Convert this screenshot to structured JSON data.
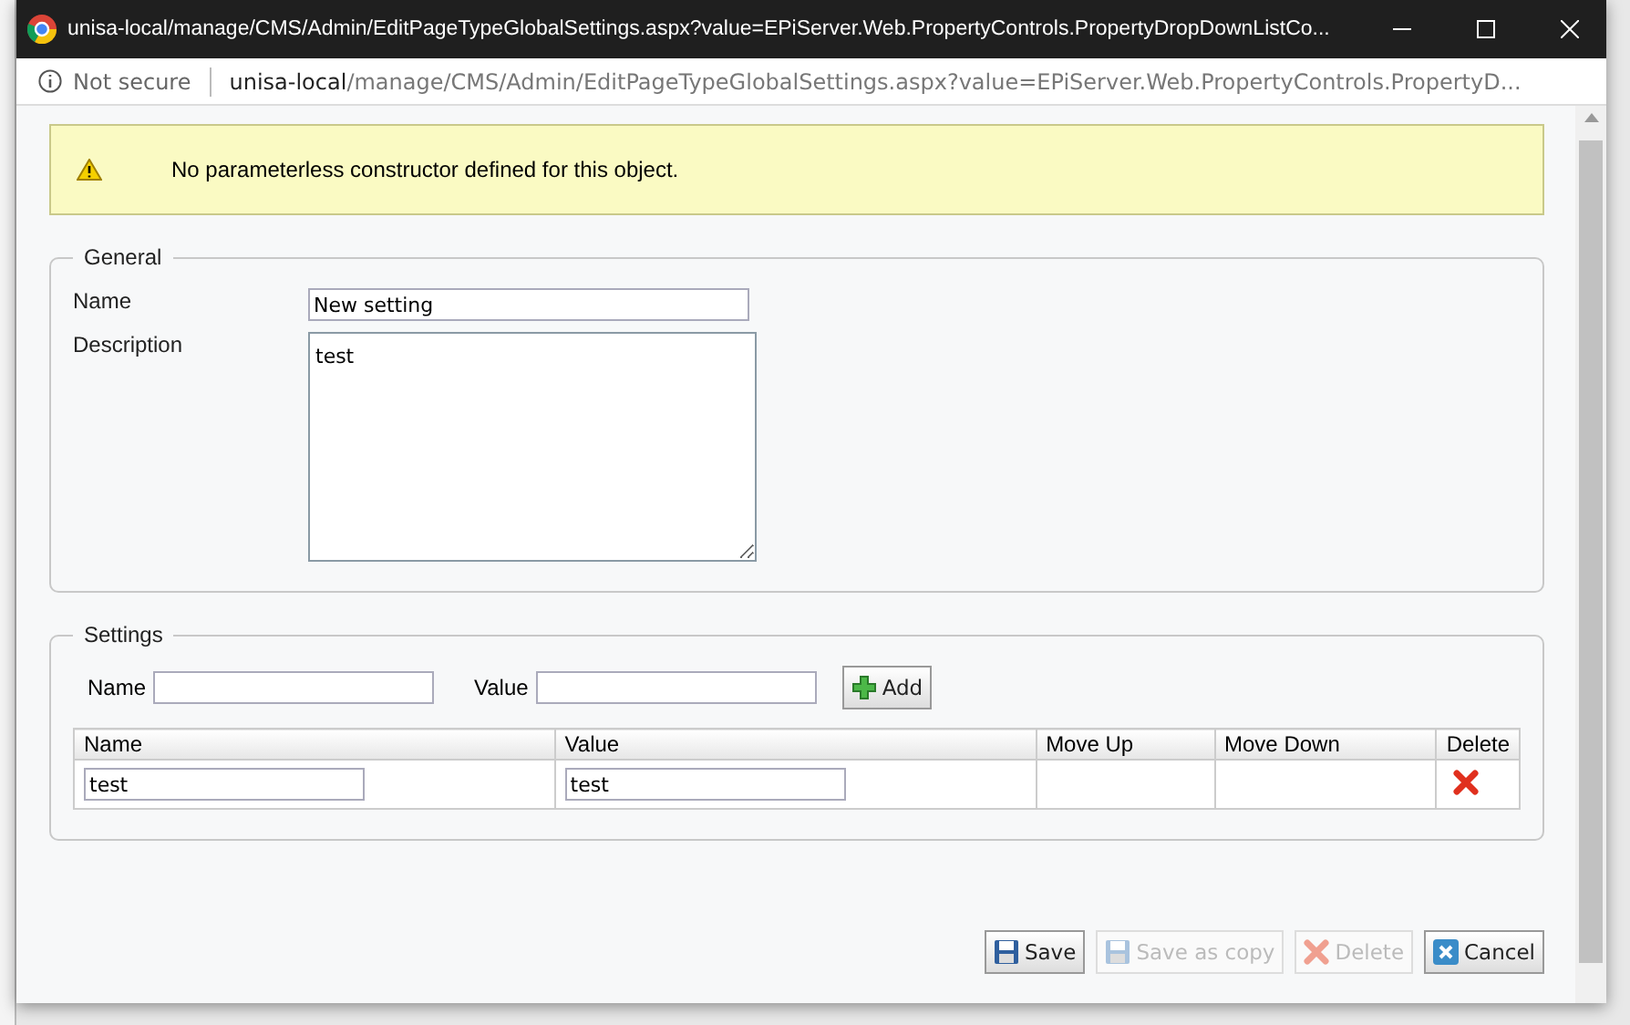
{
  "window": {
    "title": "unisa-local/manage/CMS/Admin/EditPageTypeGlobalSettings.aspx?value=EPiServer.Web.PropertyControls.PropertyDropDownListCo..."
  },
  "address_bar": {
    "security": "Not secure",
    "host": "unisa-local",
    "path": "/manage/CMS/Admin/EditPageTypeGlobalSettings.aspx?value=EPiServer.Web.PropertyControls.PropertyD..."
  },
  "warning": {
    "message": "No parameterless constructor defined for this object."
  },
  "general": {
    "legend": "General",
    "name_label": "Name",
    "name_value": "New setting",
    "description_label": "Description",
    "description_value": "test"
  },
  "settings": {
    "legend": "Settings",
    "name_label": "Name",
    "value_label": "Value",
    "add_button": "Add",
    "table": {
      "columns": [
        "Name",
        "Value",
        "Move Up",
        "Move Down",
        "Delete"
      ],
      "rows": [
        {
          "name": "test",
          "value": "test"
        }
      ]
    }
  },
  "buttons": [
    {
      "label": "Save",
      "kind": "save",
      "disabled": false
    },
    {
      "label": "Save as copy",
      "kind": "save",
      "disabled": true
    },
    {
      "label": "Delete",
      "kind": "delete",
      "disabled": true
    },
    {
      "label": "Cancel",
      "kind": "cancel",
      "disabled": false
    }
  ]
}
